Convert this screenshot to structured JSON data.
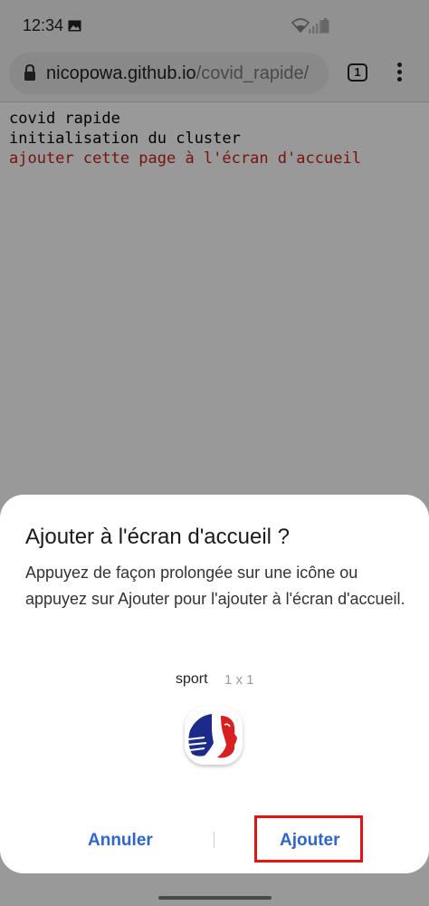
{
  "status_bar": {
    "time": "12:34"
  },
  "browser": {
    "url_host": "nicopowa.github.io",
    "url_path": "/covid_rapide/",
    "tab_count": "1"
  },
  "page": {
    "lines": [
      "covid rapide",
      "initialisation du cluster",
      "ajouter cette page à l'écran d'accueil"
    ]
  },
  "dialog": {
    "title": "Ajouter à l'écran d'accueil ?",
    "body": "Appuyez de façon prolongée sur une icône ou appuyez sur Ajouter pour l'ajouter à l'écran d'accueil.",
    "widget_name": "sport",
    "widget_size": "1 x 1",
    "cancel_label": "Annuler",
    "add_label": "Ajouter"
  },
  "colors": {
    "accent": "#2f66c8",
    "highlight": "#e11414",
    "page_link": "#c62020"
  },
  "icons": [
    "gallery-icon",
    "wifi-icon",
    "signal-icon",
    "battery-icon",
    "lock-icon",
    "tabs-icon",
    "more-vert-icon",
    "app-icon"
  ]
}
